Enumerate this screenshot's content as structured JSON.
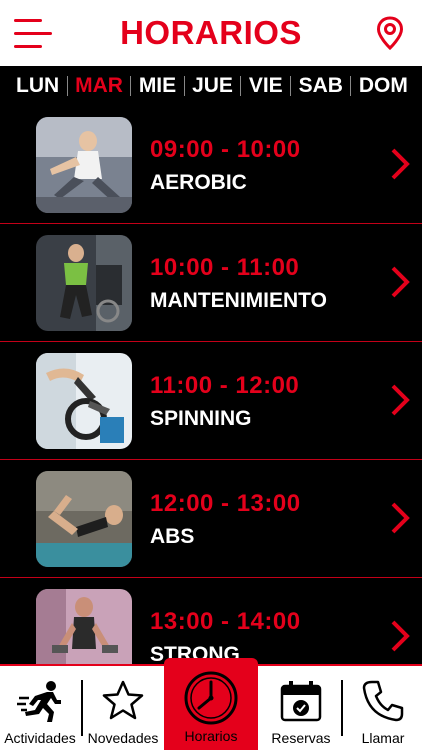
{
  "header": {
    "title": "HORARIOS",
    "menu_icon": "hamburger-icon",
    "location_icon": "map-pin-icon"
  },
  "days": [
    {
      "label": "LUN",
      "active": false
    },
    {
      "label": "MAR",
      "active": true
    },
    {
      "label": "MIE",
      "active": false
    },
    {
      "label": "JUE",
      "active": false
    },
    {
      "label": "VIE",
      "active": false
    },
    {
      "label": "SAB",
      "active": false
    },
    {
      "label": "DOM",
      "active": false
    }
  ],
  "classes": [
    {
      "time": "09:00 - 10:00",
      "name": "AEROBIC"
    },
    {
      "time": "10:00 - 11:00",
      "name": "MANTENIMIENTO"
    },
    {
      "time": "11:00 - 12:00",
      "name": "SPINNING"
    },
    {
      "time": "12:00 - 13:00",
      "name": "ABS"
    },
    {
      "time": "13:00 - 14:00",
      "name": "STRONG"
    }
  ],
  "tabs": [
    {
      "label": "Actividades",
      "icon": "runner-icon"
    },
    {
      "label": "Novedades",
      "icon": "star-icon"
    },
    {
      "label": "Horarios",
      "icon": "clock-icon",
      "active": true
    },
    {
      "label": "Reservas",
      "icon": "calendar-check-icon"
    },
    {
      "label": "Llamar",
      "icon": "phone-icon"
    }
  ],
  "colors": {
    "accent": "#e4001b",
    "background": "#000000",
    "header_bg": "#ffffff"
  }
}
